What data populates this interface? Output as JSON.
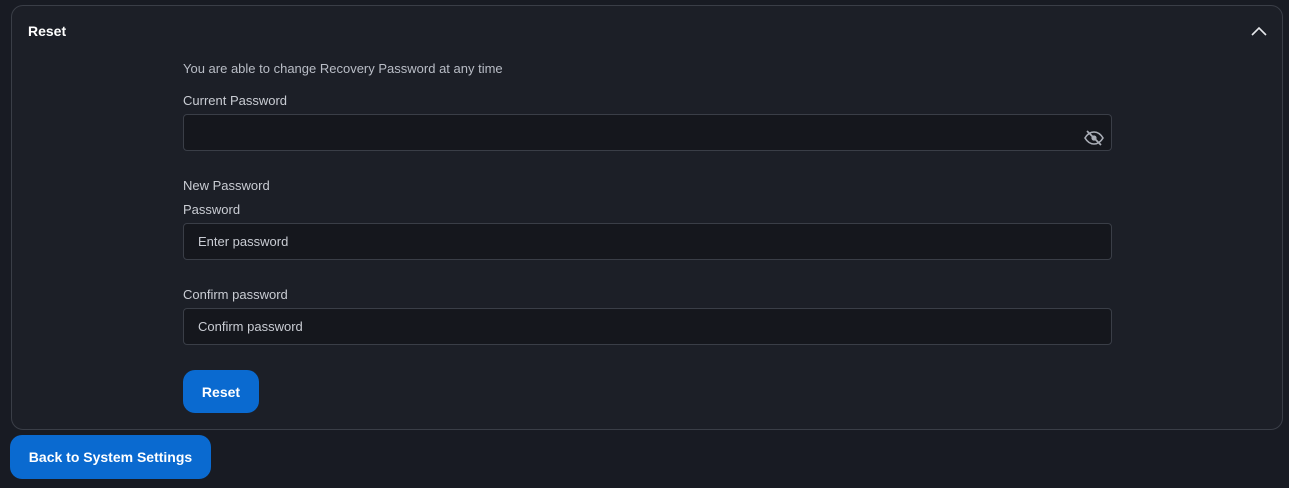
{
  "panel": {
    "title": "Reset",
    "collapse_icon": "chevron-up-icon"
  },
  "form": {
    "info": "You are able to change Recovery Password at any time",
    "current_password": {
      "label": "Current Password",
      "value": "",
      "placeholder": "",
      "visibility_icon": "eye-off-icon"
    },
    "new_password_section": "New Password",
    "password": {
      "label": "Password",
      "placeholder": "Enter password"
    },
    "confirm_password": {
      "label": "Confirm password",
      "placeholder": "Confirm password"
    },
    "submit_label": "Reset"
  },
  "footer": {
    "back_label": "Back to System Settings"
  },
  "colors": {
    "background": "#181b23",
    "panel": "#1c1f27",
    "border": "#3a3e47",
    "input_background": "#15171d",
    "accent": "#0a6ad0"
  }
}
